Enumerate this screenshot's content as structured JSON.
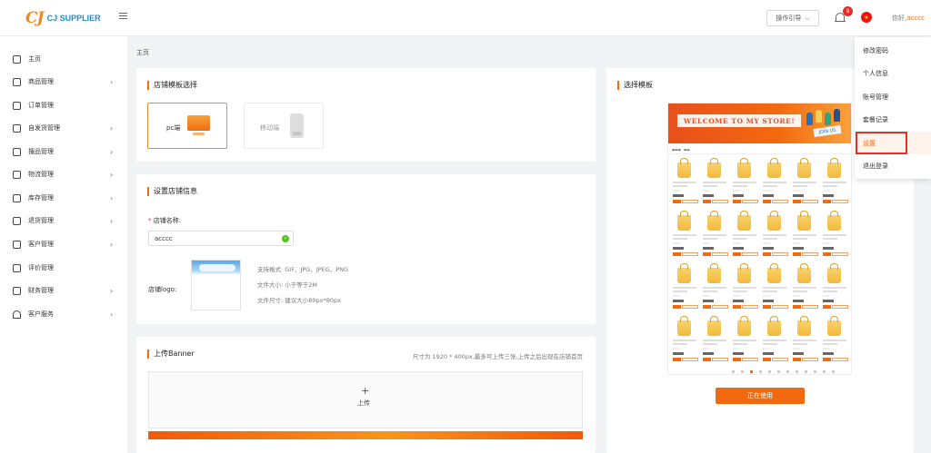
{
  "header": {
    "logo_mark": "CJ",
    "logo_text": "CJ SUPPLIER",
    "guide_label": "操作引导",
    "notification_count": "9",
    "greeting_prefix": "你好,",
    "username": "acccc"
  },
  "sidebar": {
    "items": [
      {
        "label": "主页",
        "has_arrow": false
      },
      {
        "label": "商品管理",
        "has_arrow": true
      },
      {
        "label": "订单管理",
        "has_arrow": false
      },
      {
        "label": "自发货管理",
        "has_arrow": true
      },
      {
        "label": "搜品管理",
        "has_arrow": true
      },
      {
        "label": "物流管理",
        "has_arrow": true
      },
      {
        "label": "库存管理",
        "has_arrow": true
      },
      {
        "label": "退货管理",
        "has_arrow": true
      },
      {
        "label": "客户管理",
        "has_arrow": true
      },
      {
        "label": "评价管理",
        "has_arrow": false
      },
      {
        "label": "财务管理",
        "has_arrow": true
      },
      {
        "label": "客户服务",
        "has_arrow": true
      }
    ]
  },
  "breadcrumb": "主页",
  "template_card": {
    "title": "店铺模板选择",
    "pc_label": "pc端",
    "mobile_label": "移动端"
  },
  "info_card": {
    "title": "设置店铺信息",
    "required_mark": "*",
    "name_label": "店铺名称:",
    "name_value": "acccc",
    "logo_label": "店铺logo:",
    "hints": [
      "支持格式: GIF、JPG、JPEG、PNG",
      "文件大小: 小于等于2M",
      "文件尺寸: 建议大小80px*80px"
    ]
  },
  "banner_card": {
    "title": "上传Banner",
    "hint": "尺寸为 1920 * 400px,最多可上传三张,上传之后出现在店铺首页",
    "upload_plus": "+",
    "upload_label": "上传"
  },
  "preview_card": {
    "title": "选择模板",
    "banner_text": "WELCOME TO MY STORE!",
    "join_text": "JOIN US",
    "in_use_label": "正在使用"
  },
  "dropdown": {
    "items": [
      "修改密码",
      "个人信息",
      "账号管理",
      "套餐记录",
      "设置",
      "退出登录"
    ],
    "active_index": 4
  },
  "colors": {
    "accent": "#f26a10",
    "highlight_border": "#e3312a",
    "success": "#52c41a"
  }
}
